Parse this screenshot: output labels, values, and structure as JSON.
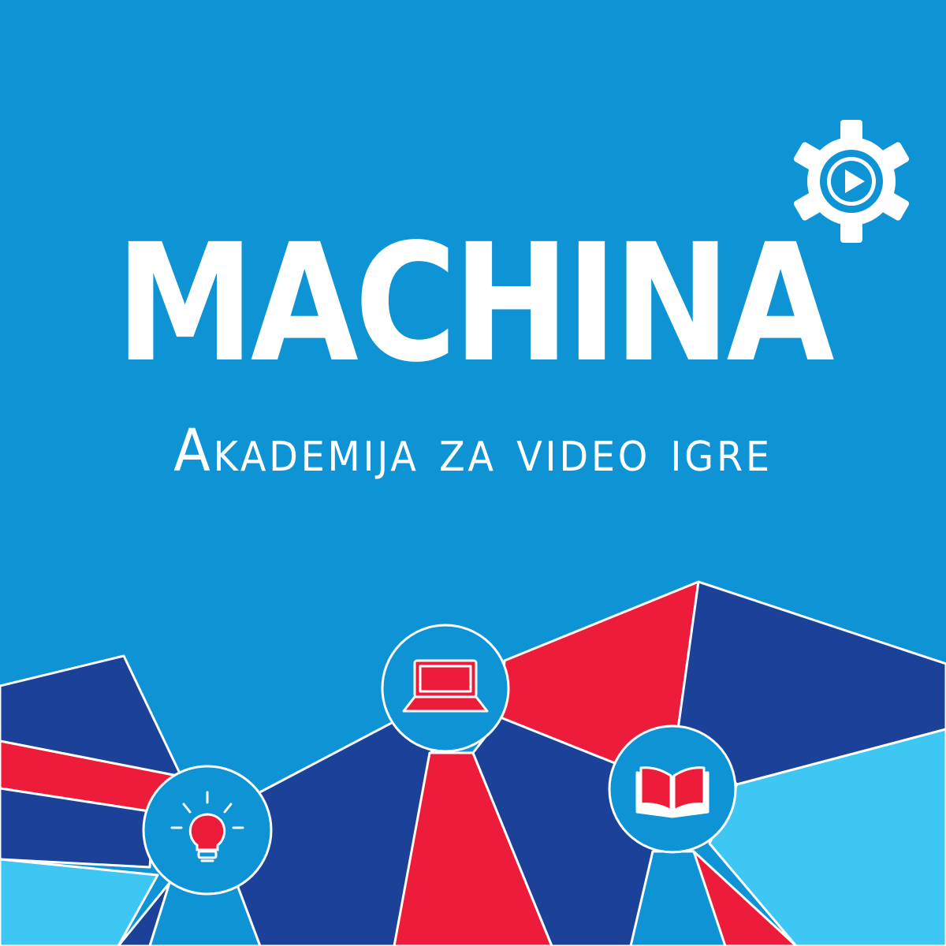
{
  "brand": {
    "title": "MACHINA",
    "subtitle": "Akademija za video igre"
  },
  "icons": [
    "gear-play-icon",
    "lightbulb-icon",
    "laptop-icon",
    "open-book-icon"
  ],
  "colors": {
    "background": "#0e94d5",
    "navy": "#1b4199",
    "red": "#ee1c3b",
    "light_blue": "#3fc7f4",
    "white": "#ffffff"
  }
}
